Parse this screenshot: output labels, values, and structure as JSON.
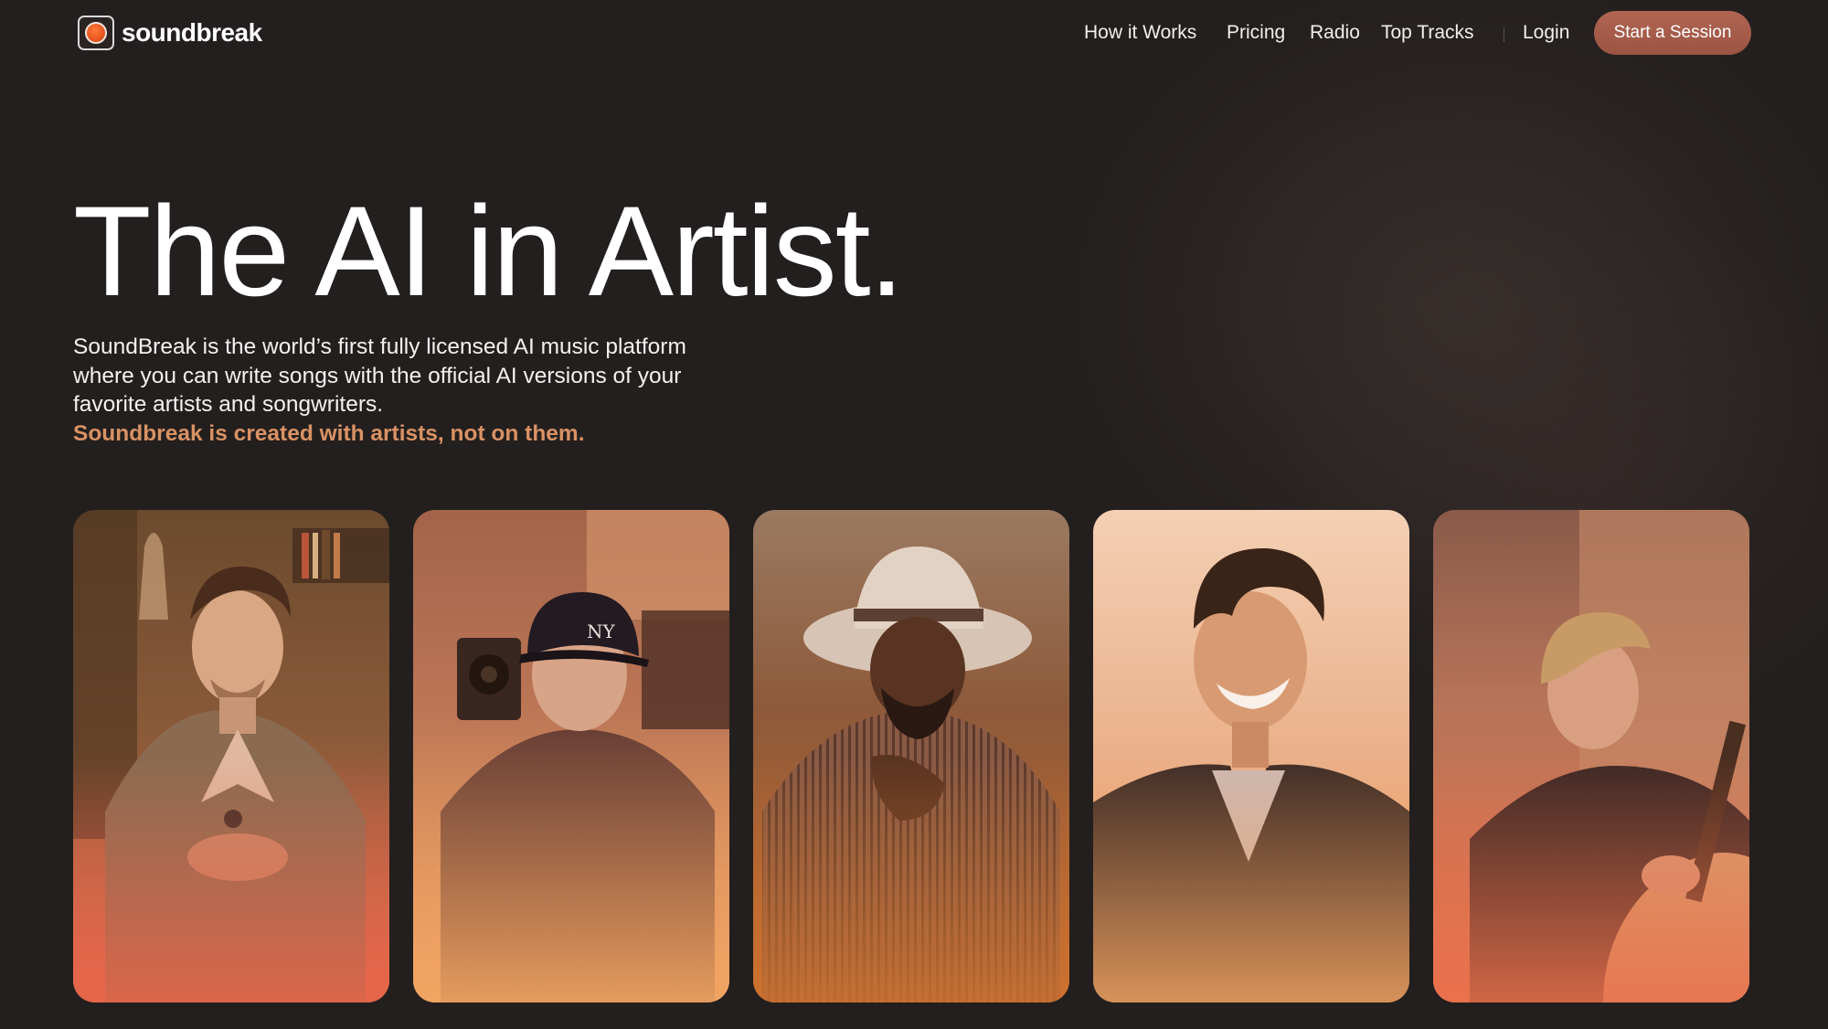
{
  "brand": {
    "name": "soundbreak",
    "logo_icon": "record-dot-icon"
  },
  "nav": {
    "items": [
      "How it Works",
      "Pricing",
      "Radio",
      "Top Tracks"
    ],
    "login": "Login",
    "cta": "Start a Session"
  },
  "hero": {
    "title": "The AI in Artist.",
    "description": "SoundBreak is the world’s first fully licensed AI music platform where you can write songs with the official AI versions of your favorite artists and songwriters.",
    "tagline": "Soundbreak is created with artists, not on them."
  },
  "artists": [
    {
      "alt": "artist-portrait-1"
    },
    {
      "alt": "artist-portrait-2"
    },
    {
      "alt": "artist-portrait-3"
    },
    {
      "alt": "artist-portrait-4"
    },
    {
      "alt": "artist-portrait-5"
    }
  ],
  "colors": {
    "background": "#231f1e",
    "accent": "#d99264",
    "cta": "#a65b49"
  }
}
